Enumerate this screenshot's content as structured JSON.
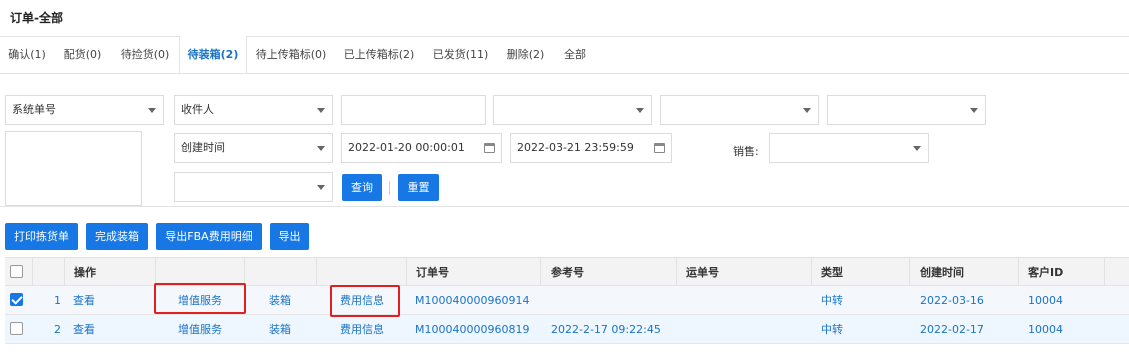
{
  "page_title": "订单-全部",
  "tabs": [
    {
      "label": "确认(1)"
    },
    {
      "label": "配货(0)"
    },
    {
      "label": "待捡货(0)"
    },
    {
      "label": "待装箱(2)",
      "active": true
    },
    {
      "label": "待上传箱标(0)"
    },
    {
      "label": "已上传箱标(2)"
    },
    {
      "label": "已发货(11)"
    },
    {
      "label": "删除(2)"
    },
    {
      "label": "全部"
    }
  ],
  "filters": {
    "field_select": "系统单号",
    "recipient_select": "收件人",
    "recipient_value": "",
    "select3": "",
    "select4": "",
    "select5": "",
    "multi_input": "",
    "time_type": "创建时间",
    "start_time": "2022-01-20 00:00:01",
    "end_time": "2022-03-21 23:59:59",
    "sales_label": "销售:",
    "sales_value": "",
    "extra_select": "",
    "query_label": "查询",
    "reset_label": "重置"
  },
  "actions": {
    "print_pick": "打印拣货单",
    "finish_pack": "完成装箱",
    "export_fba": "导出FBA费用明细",
    "export": "导出"
  },
  "table": {
    "headers": {
      "op": "操作",
      "order_no": "订单号",
      "ref_no": "参考号",
      "waybill": "运单号",
      "type": "类型",
      "created": "创建时间",
      "customer": "客户ID"
    },
    "rows": [
      {
        "checked": true,
        "index": "1",
        "view": "查看",
        "value_added": "增值服务",
        "pack": "装箱",
        "fee": "费用信息",
        "order_no": "M100040000960914",
        "ref_no": "",
        "waybill": "",
        "type": "中转",
        "created": "2022-03-16",
        "customer": "10004"
      },
      {
        "checked": false,
        "index": "2",
        "view": "查看",
        "value_added": "增值服务",
        "pack": "装箱",
        "fee": "费用信息",
        "order_no": "M100040000960819",
        "ref_no": "2022-2-17 09:22:45",
        "waybill": "",
        "type": "中转",
        "created": "2022-02-17",
        "customer": "10004"
      }
    ]
  },
  "colors": {
    "accent": "#1677e5",
    "link": "#1a73c8",
    "highlight": "#e02020"
  }
}
